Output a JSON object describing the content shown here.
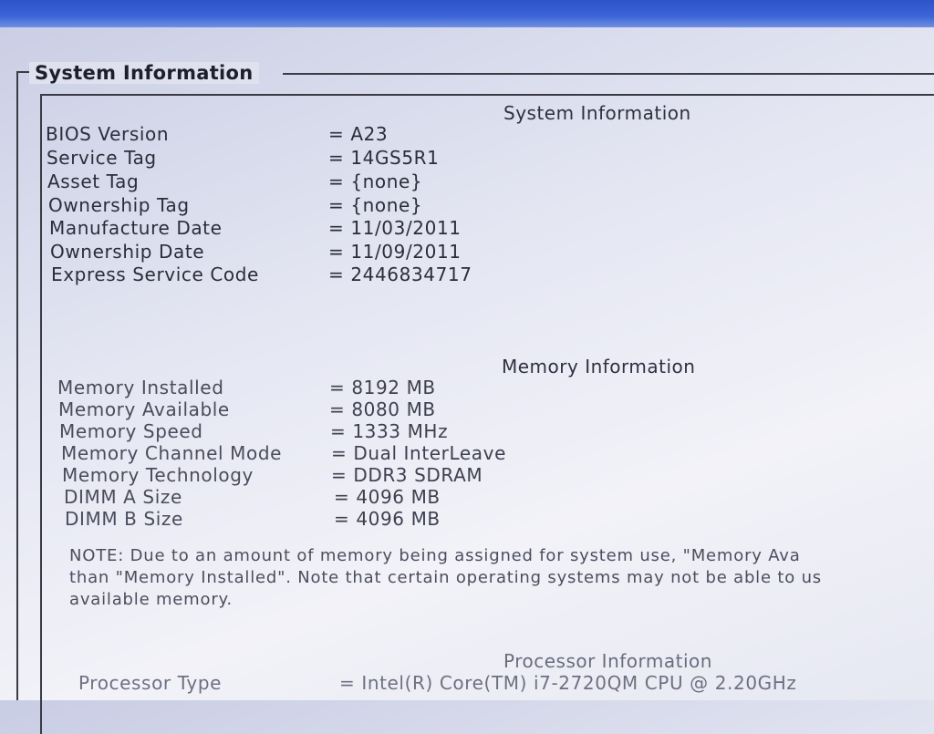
{
  "group_title": "System Information",
  "system": {
    "title": "System Information",
    "rows": [
      {
        "label": "BIOS Version",
        "value": "= A23"
      },
      {
        "label": "Service Tag",
        "value": "= 14GS5R1"
      },
      {
        "label": "Asset Tag",
        "value": "= {none}"
      },
      {
        "label": "Ownership Tag",
        "value": "= {none}"
      },
      {
        "label": "Manufacture Date",
        "value": "= 11/03/2011"
      },
      {
        "label": "Ownership Date",
        "value": "= 11/09/2011"
      },
      {
        "label": "Express Service Code",
        "value": "= 2446834717"
      }
    ]
  },
  "memory": {
    "title": "Memory Information",
    "rows": [
      {
        "label": "Memory Installed",
        "value": "= 8192 MB"
      },
      {
        "label": "Memory Available",
        "value": "= 8080 MB"
      },
      {
        "label": "Memory Speed",
        "value": "= 1333 MHz"
      },
      {
        "label": "Memory Channel Mode",
        "value": "= Dual InterLeave"
      },
      {
        "label": "Memory Technology",
        "value": "= DDR3 SDRAM"
      },
      {
        "label": "DIMM A Size",
        "value": "= 4096 MB"
      },
      {
        "label": "DIMM B Size",
        "value": "= 4096 MB"
      }
    ],
    "note_lines": [
      "NOTE: Due to an amount of memory being assigned for system use, \"Memory Ava",
      "than \"Memory Installed\". Note that certain operating systems may not be able to us",
      "available memory."
    ]
  },
  "processor": {
    "title": "Processor Information",
    "rows": [
      {
        "label": "Processor Type",
        "value": "= Intel(R) Core(TM) i7-2720QM CPU @ 2.20GHz"
      }
    ]
  }
}
